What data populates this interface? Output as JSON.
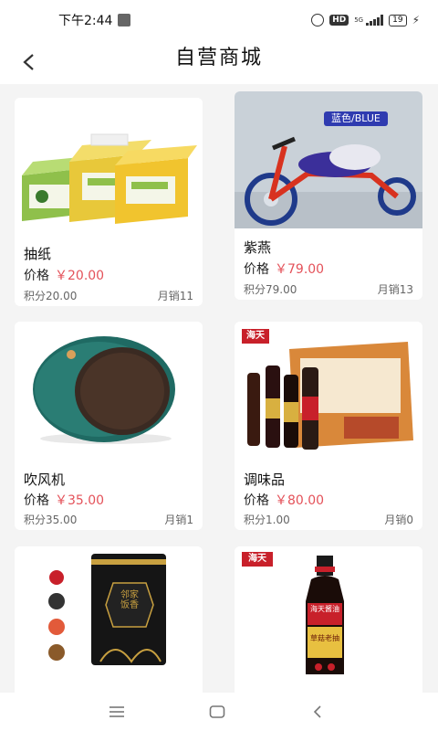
{
  "status_bar": {
    "time": "下午2:44",
    "network": "5G",
    "battery": "19"
  },
  "header": {
    "title": "自营商城"
  },
  "products": [
    {
      "name": "抽纸",
      "price_label": "价格",
      "price": "￥20.00",
      "points": "积分20.00",
      "sales": "月销11"
    },
    {
      "name": "紫燕",
      "price_label": "价格",
      "price": "￥79.00",
      "points": "积分79.00",
      "sales": "月销13",
      "tag": "蓝色/BLUE"
    },
    {
      "name": "吹风机",
      "price_label": "价格",
      "price": "￥35.00",
      "points": "积分35.00",
      "sales": "月销1"
    },
    {
      "name": "调味品",
      "price_label": "价格",
      "price": "￥80.00",
      "points": "积分1.00",
      "sales": "月销0",
      "brand": "海天"
    },
    {
      "brand_badge": "邻家饭香"
    },
    {
      "brand": "海天",
      "bottle_label": "海天酱油",
      "bottle_sub": "草菇老抽"
    }
  ],
  "colors": {
    "price": "#e4525a",
    "brand_red": "#c8202a",
    "speaker_green": "#1f6a63"
  }
}
